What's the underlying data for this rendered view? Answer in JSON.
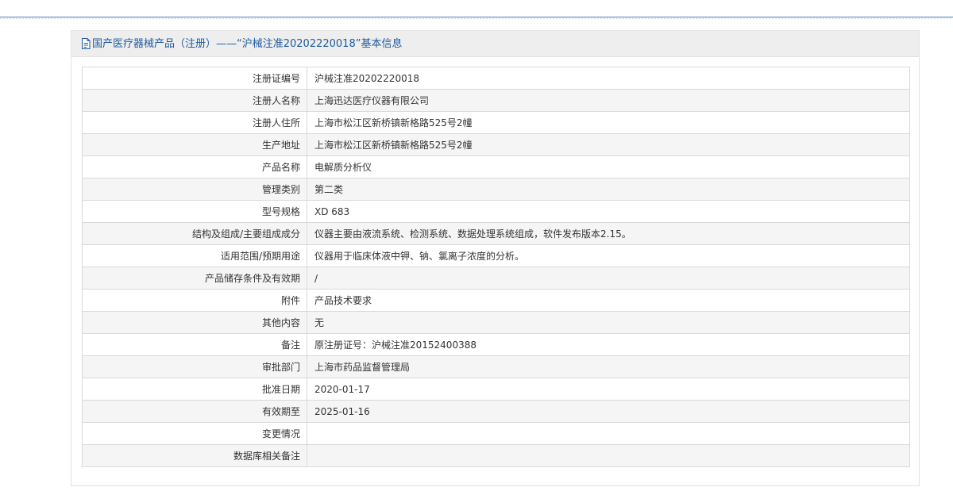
{
  "header": {
    "title": "国产医疗器械产品（注册）——“沪械注准20202220018”基本信息",
    "icon": "document-icon",
    "title_color": "#1e5a9e"
  },
  "rows": [
    {
      "label": "注册证编号",
      "value": "沪械注准20202220018"
    },
    {
      "label": "注册人名称",
      "value": "上海迅达医疗仪器有限公司"
    },
    {
      "label": "注册人住所",
      "value": "上海市松江区新桥镇新格路525号2幢"
    },
    {
      "label": "生产地址",
      "value": "上海市松江区新桥镇新格路525号2幢"
    },
    {
      "label": "产品名称",
      "value": "电解质分析仪"
    },
    {
      "label": "管理类别",
      "value": "第二类"
    },
    {
      "label": "型号规格",
      "value": "XD 683"
    },
    {
      "label": "结构及组成/主要组成成分",
      "value": "仪器主要由液流系统、检测系统、数据处理系统组成，软件发布版本2.15。"
    },
    {
      "label": "适用范围/预期用途",
      "value": "仪器用于临床体液中钾、钠、氯离子浓度的分析。"
    },
    {
      "label": "产品储存条件及有效期",
      "value": "/"
    },
    {
      "label": "附件",
      "value": "产品技术要求"
    },
    {
      "label": "其他内容",
      "value": "无"
    },
    {
      "label": "备注",
      "value": "原注册证号：沪械注准20152400388"
    },
    {
      "label": "审批部门",
      "value": "上海市药品监督管理局"
    },
    {
      "label": "批准日期",
      "value": "2020-01-17"
    },
    {
      "label": "有效期至",
      "value": "2025-01-16"
    },
    {
      "label": "变更情况",
      "value": ""
    },
    {
      "label": "数据库相关备注",
      "value": ""
    }
  ]
}
